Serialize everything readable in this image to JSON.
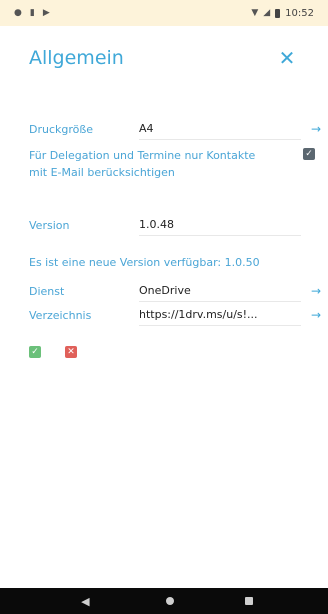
{
  "status_bar": {
    "time": "10:52",
    "left_icons": [
      "notification-dot-icon",
      "sim-icon",
      "play-store-icon"
    ],
    "right_icons": [
      "wifi-icon",
      "signal-icon",
      "battery-icon"
    ]
  },
  "header": {
    "title": "Allgemein",
    "close_icon": "close-icon"
  },
  "settings": {
    "print_size": {
      "label": "Druckgröße",
      "value": "A4"
    },
    "delegation": {
      "label": "Für Delegation und Termine nur Kontakte mit E-Mail berücksichtigen",
      "checked": true
    },
    "version": {
      "label": "Version",
      "value": "1.0.48"
    },
    "update_notice": "Es ist eine neue Version verfügbar: 1.0.50",
    "service": {
      "label": "Dienst",
      "value": "OneDrive"
    },
    "directory": {
      "label": "Verzeichnis",
      "value": "https://1drv.ms/u/s!..."
    }
  },
  "actions": {
    "confirm_icon": "check-icon",
    "cancel_icon": "x-icon"
  },
  "nav_bar": {
    "icons": [
      "back-icon",
      "home-icon",
      "recents-icon"
    ]
  },
  "colors": {
    "accent": "#3fa8d8",
    "status_bar_bg": "#fdf3da",
    "confirm": "#6bc07a",
    "cancel": "#e0605a"
  }
}
